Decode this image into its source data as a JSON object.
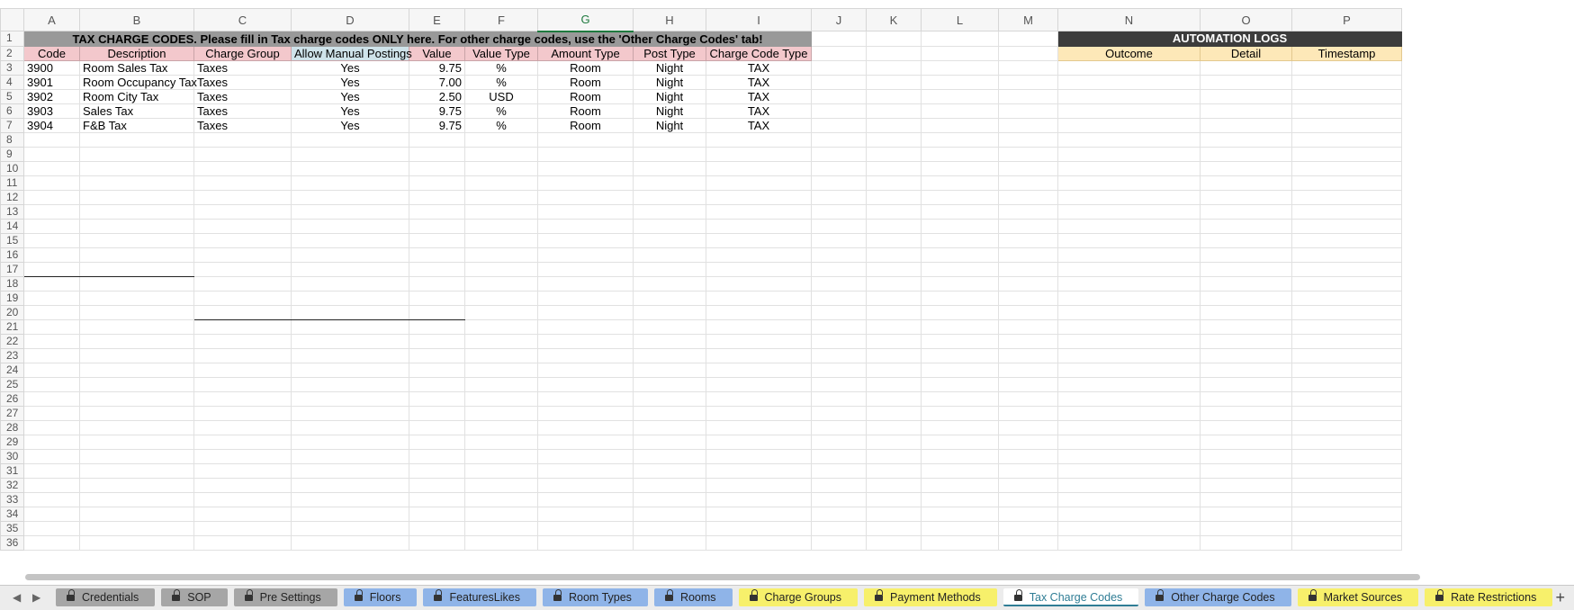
{
  "columns": [
    "A",
    "B",
    "C",
    "D",
    "E",
    "F",
    "G",
    "H",
    "I",
    "J",
    "K",
    "L",
    "M",
    "N",
    "O",
    "P"
  ],
  "selected_column": "G",
  "rows": [
    "1",
    "2",
    "3",
    "4",
    "5",
    "6",
    "7",
    "8",
    "9",
    "10",
    "11",
    "12",
    "13",
    "14",
    "15",
    "16",
    "17",
    "18",
    "19",
    "20",
    "21",
    "22",
    "23",
    "24",
    "25",
    "26",
    "27",
    "28",
    "29",
    "30",
    "31",
    "32",
    "33",
    "34",
    "35",
    "36"
  ],
  "banner": "TAX CHARGE CODES. Please fill in Tax charge codes ONLY here. For other charge codes, use the 'Other Charge Codes' tab!",
  "headers": [
    "Code",
    "Description",
    "Charge Group",
    "Allow Manual Postings",
    "Value",
    "Value Type",
    "Amount Type",
    "Post Type",
    "Charge Code Type"
  ],
  "data_rows": [
    [
      "3900",
      "Room Sales Tax",
      "Taxes",
      "Yes",
      "9.75",
      "%",
      "Room",
      "Night",
      "TAX"
    ],
    [
      "3901",
      "Room Occupancy Tax",
      "Taxes",
      "Yes",
      "7.00",
      "%",
      "Room",
      "Night",
      "TAX"
    ],
    [
      "3902",
      "Room City Tax",
      "Taxes",
      "Yes",
      "2.50",
      "USD",
      "Room",
      "Night",
      "TAX"
    ],
    [
      "3903",
      "Sales Tax",
      "Taxes",
      "Yes",
      "9.75",
      "%",
      "Room",
      "Night",
      "TAX"
    ],
    [
      "3904",
      "F&B Tax",
      "Taxes",
      "Yes",
      "9.75",
      "%",
      "Room",
      "Night",
      "TAX"
    ]
  ],
  "automation": {
    "title": "AUTOMATION LOGS",
    "headers": [
      "Outcome",
      "Detail",
      "Timestamp"
    ]
  },
  "tabs": [
    {
      "label": "Credentials",
      "color": "#a6a6a6",
      "locked": true
    },
    {
      "label": "SOP",
      "color": "#a6a6a6",
      "locked": true
    },
    {
      "label": "Pre Settings",
      "color": "#a6a6a6",
      "locked": true
    },
    {
      "label": "Floors",
      "color": "#8fb4e8",
      "locked": true
    },
    {
      "label": "FeaturesLikes",
      "color": "#8fb4e8",
      "locked": true
    },
    {
      "label": "Room Types",
      "color": "#8fb4e8",
      "locked": true
    },
    {
      "label": "Rooms",
      "color": "#8fb4e8",
      "locked": true
    },
    {
      "label": "Charge Groups",
      "color": "#f7f06b",
      "locked": true
    },
    {
      "label": "Payment Methods",
      "color": "#f7f06b",
      "locked": true
    },
    {
      "label": "Tax Charge Codes",
      "color": "#ffffff",
      "locked": true,
      "active": true
    },
    {
      "label": "Other Charge Codes",
      "color": "#8fb4e8",
      "locked": true
    },
    {
      "label": "Market Sources",
      "color": "#f7f06b",
      "locked": true
    },
    {
      "label": "Rate Restrictions",
      "color": "#f7f06b",
      "locked": true
    }
  ],
  "nav_prev": "◀",
  "nav_next": "▶",
  "add_sheet": "+"
}
